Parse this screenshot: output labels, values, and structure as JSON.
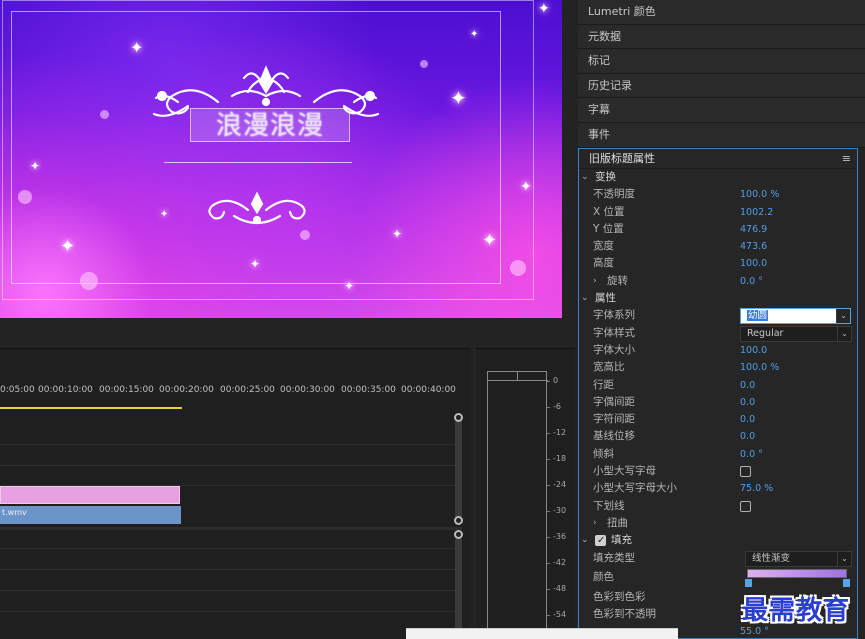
{
  "monitor": {
    "title_text": "浪漫浪漫"
  },
  "panels": [
    {
      "label": "Lumetri 颜色"
    },
    {
      "label": "元数据"
    },
    {
      "label": "标记"
    },
    {
      "label": "历史记录"
    },
    {
      "label": "字幕"
    },
    {
      "label": "事件"
    }
  ],
  "legacy_title": {
    "header": "旧版标题属性",
    "menu_icon": "hamburger-icon",
    "transform": {
      "label": "变换",
      "opacity": {
        "label": "不透明度",
        "value": "100.0 %"
      },
      "x": {
        "label": "X 位置",
        "value": "1002.2"
      },
      "y": {
        "label": "Y 位置",
        "value": "476.9"
      },
      "width": {
        "label": "宽度",
        "value": "473.6"
      },
      "height": {
        "label": "高度",
        "value": "100.0"
      },
      "rotation": {
        "label": "旋转",
        "value": "0.0 °"
      }
    },
    "properties": {
      "label": "属性",
      "font_family": {
        "label": "字体系列",
        "value": "幼圆"
      },
      "font_style": {
        "label": "字体样式",
        "value": "Regular"
      },
      "font_size": {
        "label": "字体大小",
        "value": "100.0"
      },
      "aspect": {
        "label": "宽高比",
        "value": "100.0 %"
      },
      "leading": {
        "label": "行距",
        "value": "0.0"
      },
      "kerning": {
        "label": "字偶间距",
        "value": "0.0"
      },
      "tracking": {
        "label": "字符间距",
        "value": "0.0"
      },
      "baseline": {
        "label": "基线位移",
        "value": "0.0"
      },
      "slant": {
        "label": "倾斜",
        "value": "0.0 °"
      },
      "small_caps": {
        "label": "小型大写字母"
      },
      "small_caps_size": {
        "label": "小型大写字母大小",
        "value": "75.0 %"
      },
      "underline": {
        "label": "下划线"
      },
      "distort": {
        "label": "扭曲"
      }
    },
    "fill": {
      "label": "填充",
      "fill_type": {
        "label": "填充类型",
        "value": "线性渐变"
      },
      "color": {
        "label": "颜色"
      },
      "color_to_color": {
        "label": "色彩到色彩"
      },
      "color_to_opacity": {
        "label": "色彩到不透明"
      },
      "angle_value": "55.0 °"
    }
  },
  "timeline": {
    "timecodes": [
      "0:05:00",
      "00:00:10:00",
      "00:00:15:00",
      "00:00:20:00",
      "00:00:25:00",
      "00:00:30:00",
      "00:00:35:00",
      "00:00:40:00"
    ],
    "clip_blue_label": "t.wmv",
    "playhead_color": "#e8d42a",
    "clip_colors": {
      "pink": "#e7a0e0",
      "blue": "#6b95c8"
    }
  },
  "audio_meter": {
    "db_labels": [
      "0",
      "-6",
      "-12",
      "-18",
      "-24",
      "-30",
      "-36",
      "-42",
      "-48",
      "-54"
    ]
  },
  "watermark": "最需教育"
}
